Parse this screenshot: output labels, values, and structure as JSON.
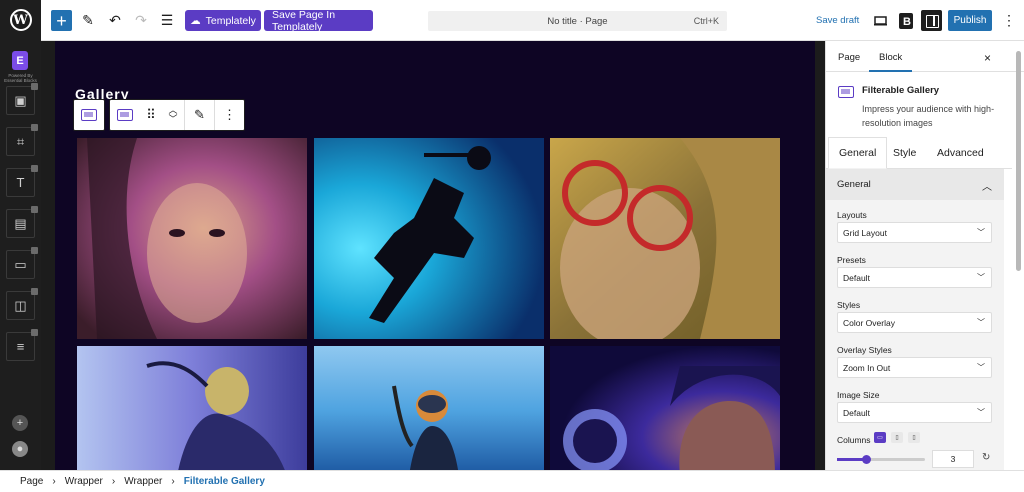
{
  "topbar": {
    "templately_label": "Templately",
    "save_templately_label": "Save Page In Templately",
    "document_title": "No title · Page",
    "shortcut": "Ctrl+K",
    "save_draft": "Save draft",
    "publish": "Publish"
  },
  "sidebar": {
    "brand_mark": "E",
    "powered_by": "Powered By Essential Blocks",
    "items": [
      "gallery-block",
      "image-block",
      "text-block",
      "cart-block",
      "button-block",
      "media-block",
      "form-block"
    ]
  },
  "canvas": {
    "gallery_title": "Gallery",
    "images": [
      {
        "name": "woman-portrait-magenta",
        "colors": [
          "#3b1d2a",
          "#a34f86",
          "#d9a087"
        ]
      },
      {
        "name": "diver-silhouette-blue",
        "colors": [
          "#0a2f6b",
          "#1aa7d8",
          "#0b0b15"
        ]
      },
      {
        "name": "woman-glasses-yellow",
        "colors": [
          "#6b5a24",
          "#c9a64a",
          "#2a1f0f"
        ]
      },
      {
        "name": "diver-underwater-purple",
        "colors": [
          "#3d3d9c",
          "#7e7fd9",
          "#c8b46a"
        ]
      },
      {
        "name": "diver-mask-blue",
        "colors": [
          "#1b56a0",
          "#4fa3e0",
          "#d88a3a"
        ]
      },
      {
        "name": "man-goggles-dark",
        "colors": [
          "#0f0a3a",
          "#3c2a9c",
          "#c97d5a"
        ]
      }
    ]
  },
  "panel": {
    "tab_page": "Page",
    "tab_block": "Block",
    "close": "×",
    "block_name": "Filterable Gallery",
    "block_desc": "Impress your audience with high-resolution images",
    "inner_tabs": [
      "General",
      "Style",
      "Advanced"
    ],
    "section_title": "General",
    "fields": [
      {
        "label": "Layouts",
        "value": "Grid Layout"
      },
      {
        "label": "Presets",
        "value": "Default"
      },
      {
        "label": "Styles",
        "value": "Color Overlay"
      },
      {
        "label": "Overlay Styles",
        "value": "Zoom In Out"
      },
      {
        "label": "Image Size",
        "value": "Default"
      }
    ],
    "columns_label": "Columns",
    "columns_value": "3",
    "columns_fraction": 0.33
  },
  "breadcrumb": [
    "Page",
    "Wrapper",
    "Wrapper",
    "Filterable Gallery"
  ],
  "colors": {
    "accent": "#2271b1",
    "brand": "#5b3cc4",
    "canvas_bg": "#0e0524"
  }
}
